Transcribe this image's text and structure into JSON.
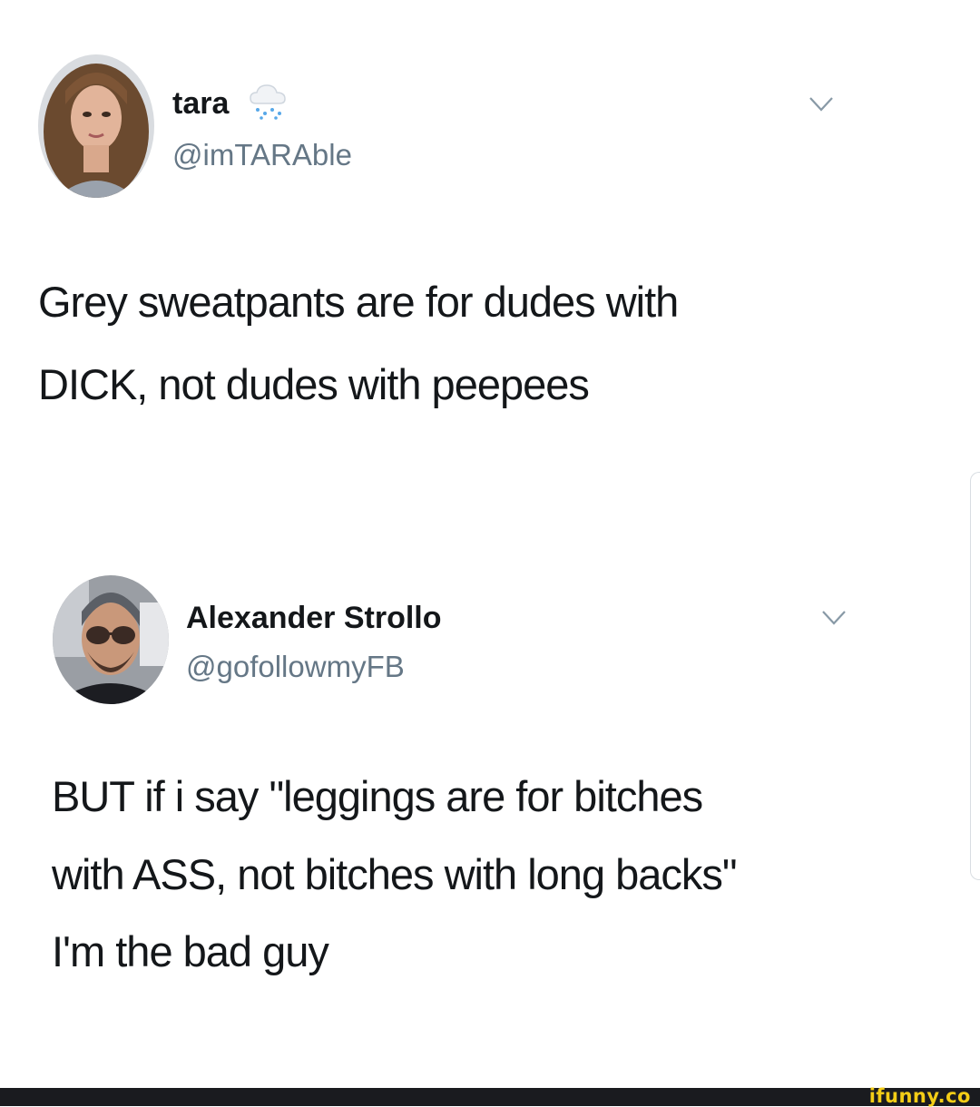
{
  "tweets": [
    {
      "display_name": "tara",
      "name_emoji_icon": "rain-cloud-icon",
      "handle": "@imTARAble",
      "menu_icon": "chevron-down-icon",
      "body_lines": [
        "Grey sweatpants are for dudes with",
        "DICK, not dudes with peepees"
      ]
    },
    {
      "display_name": "Alexander Strollo",
      "handle": "@gofollowmyFB",
      "menu_icon": "chevron-down-icon",
      "body_lines": [
        "BUT if i say \"leggings are for bitches",
        "with ASS, not bitches with long backs\"",
        "I'm the bad guy"
      ]
    }
  ],
  "watermark": "ifunny.co",
  "colors": {
    "text_primary": "#14171a",
    "text_secondary": "#657786",
    "chevron": "#8899a6",
    "watermark_bar": "#1a1b1f",
    "watermark_text": "#f4cd16"
  }
}
